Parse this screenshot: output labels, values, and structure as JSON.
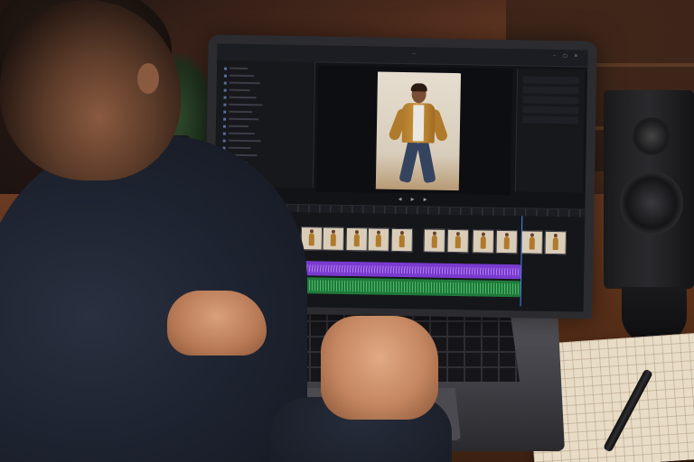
{
  "scene": {
    "description_free": true
  },
  "editor": {
    "colors": {
      "background": "#121317",
      "panel": "#17181c",
      "accent_blue": "#4a8af0",
      "audio_purple": "#7a3ad0",
      "audio_green": "#1f7a3a"
    },
    "icons": {
      "menu": "menu-icon",
      "minimize": "minimize-icon",
      "maximize": "maximize-icon",
      "close": "close-icon",
      "play": "play-icon",
      "rewind": "rewind-icon",
      "forward": "forward-icon"
    },
    "glyphs": {
      "menu": "⋯",
      "minimize": "–",
      "maximize": "▢",
      "close": "✕",
      "rewind": "◀",
      "play": "▶",
      "forward": "▶"
    },
    "left_panel_item_count": 16,
    "right_panel_row_count": 5,
    "timeline_clip_count": 12
  }
}
